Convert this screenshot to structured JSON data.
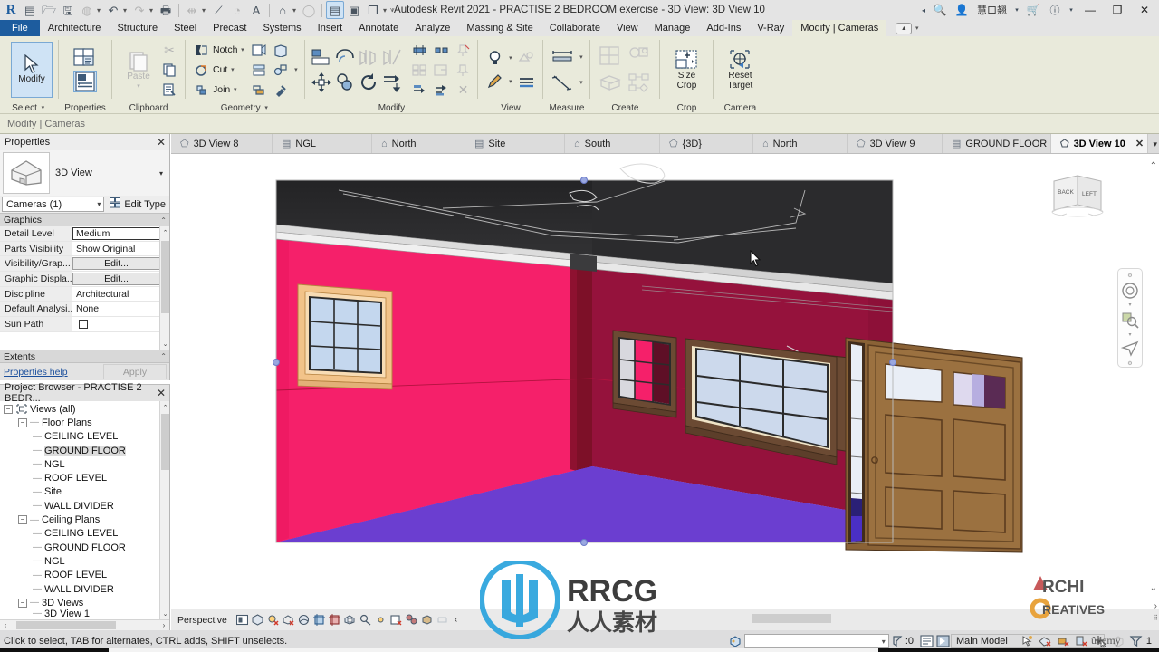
{
  "app": {
    "title": "Autodesk Revit 2021 - PRACTISE 2 BEDROOM exercise - 3D View: 3D View 10",
    "user": "慧口翘",
    "brand_color": "#1d5c9e",
    "ribbon_bg": "#e9eadb"
  },
  "quick_access": {
    "logo": "R",
    "items": [
      {
        "name": "new-project-icon",
        "glyph": "▤"
      },
      {
        "name": "open-icon",
        "glyph": "🗁"
      },
      {
        "name": "save-icon",
        "glyph": "🖫"
      },
      {
        "name": "save-as-icon",
        "glyph": "⬓"
      },
      {
        "name": "undo-icon",
        "glyph": "↶"
      },
      {
        "name": "redo-icon",
        "glyph": "↷"
      },
      {
        "name": "print-icon",
        "glyph": "🖨"
      },
      {
        "name": "measure-icon",
        "glyph": "⇹"
      },
      {
        "name": "aligned-dimension-icon",
        "glyph": "↗"
      },
      {
        "name": "tag-icon",
        "glyph": "◔"
      },
      {
        "name": "text-icon",
        "glyph": "A"
      },
      {
        "name": "default-3d-view-icon",
        "glyph": "⌂"
      },
      {
        "name": "section-icon",
        "glyph": "◯"
      },
      {
        "name": "thin-lines-icon",
        "glyph": "▤"
      },
      {
        "name": "close-hidden-windows-icon",
        "glyph": "▣"
      },
      {
        "name": "switch-windows-icon",
        "glyph": "❐"
      },
      {
        "name": "customize-qat-icon",
        "glyph": "▾"
      }
    ]
  },
  "window_controls": {
    "minimize": "—",
    "restore": "❐",
    "close": "✕",
    "search_icon": "🔍",
    "user_icon": "👤",
    "cart_icon": "🛒",
    "help_icon": "?",
    "prev_arrow": "◂"
  },
  "ribbon_tabs": {
    "items": [
      {
        "label": "File",
        "active": false,
        "file": true
      },
      {
        "label": "Architecture",
        "active": false
      },
      {
        "label": "Structure",
        "active": false
      },
      {
        "label": "Steel",
        "active": false
      },
      {
        "label": "Precast",
        "active": false
      },
      {
        "label": "Systems",
        "active": false
      },
      {
        "label": "Insert",
        "active": false
      },
      {
        "label": "Annotate",
        "active": false
      },
      {
        "label": "Analyze",
        "active": false
      },
      {
        "label": "Massing & Site",
        "active": false
      },
      {
        "label": "Collaborate",
        "active": false
      },
      {
        "label": "View",
        "active": false
      },
      {
        "label": "Manage",
        "active": false
      },
      {
        "label": "Add-Ins",
        "active": false
      },
      {
        "label": "V-Ray",
        "active": false
      },
      {
        "label": "Modify | Cameras",
        "active": true
      }
    ]
  },
  "ribbon_panels": {
    "select": {
      "title": "Select",
      "modify_label": "Modify",
      "modify_icon": "cursor-arrow-icon"
    },
    "properties": {
      "title": "Properties",
      "buttons": [
        {
          "name": "type-properties-icon"
        },
        {
          "name": "properties-palette-icon"
        }
      ]
    },
    "clipboard": {
      "title": "Clipboard",
      "paste_label": "Paste",
      "buttons": [
        {
          "name": "cut-icon"
        },
        {
          "name": "copy-icon"
        },
        {
          "name": "match-type-properties-icon"
        }
      ]
    },
    "geometry": {
      "title": "Geometry",
      "items": [
        {
          "name": "notch-button",
          "label": "Notch"
        },
        {
          "name": "cut-button",
          "label": "Cut"
        },
        {
          "name": "join-button",
          "label": "Join"
        }
      ]
    },
    "modify": {
      "title": "Modify",
      "items": [
        {
          "name": "align-icon"
        },
        {
          "name": "offset-icon"
        },
        {
          "name": "mirror-pick-axis-icon"
        },
        {
          "name": "mirror-draw-axis-icon"
        },
        {
          "name": "move-icon"
        },
        {
          "name": "copy-icon"
        },
        {
          "name": "rotate-icon"
        },
        {
          "name": "array-icon"
        },
        {
          "name": "trim-extend-icon"
        },
        {
          "name": "split-icon"
        },
        {
          "name": "pin-icon"
        },
        {
          "name": "unpin-icon"
        },
        {
          "name": "delete-icon"
        },
        {
          "name": "scale-icon"
        }
      ]
    },
    "view": {
      "title": "View",
      "items": [
        {
          "name": "hide-reveal-icon"
        },
        {
          "name": "render-icon"
        },
        {
          "name": "paint-icon"
        },
        {
          "name": "linework-icon"
        }
      ]
    },
    "measure": {
      "title": "Measure",
      "items": [
        {
          "name": "measure-between-references-icon"
        },
        {
          "name": "measure-along-element-icon"
        }
      ]
    },
    "create": {
      "title": "Create",
      "items": [
        {
          "name": "create-similar-icon"
        },
        {
          "name": "create-group-icon"
        },
        {
          "name": "create-part-icon"
        },
        {
          "name": "create-assembly-icon"
        }
      ]
    },
    "crop": {
      "title": "Crop",
      "button": {
        "name": "size-crop-button",
        "line1": "Size",
        "line2": "Crop"
      }
    },
    "camera": {
      "title": "Camera",
      "button": {
        "name": "reset-target-button",
        "line1": "Reset",
        "line2": "Target"
      }
    }
  },
  "options_bar": {
    "label": "Modify | Cameras"
  },
  "properties_palette": {
    "header": "Properties",
    "close": "✕",
    "type_name": "3D View",
    "instance_selector": "Cameras (1)",
    "edit_type": "Edit Type",
    "groups": [
      {
        "name": "Graphics",
        "rows": [
          {
            "name": "Detail Level",
            "value": "Medium",
            "kind": "boxed"
          },
          {
            "name": "Parts Visibility",
            "value": "Show Original",
            "kind": "text"
          },
          {
            "name": "Visibility/Grap...",
            "value": "Edit...",
            "kind": "button"
          },
          {
            "name": "Graphic Displa...",
            "value": "Edit...",
            "kind": "button"
          },
          {
            "name": "Discipline",
            "value": "Architectural",
            "kind": "text"
          },
          {
            "name": "Default Analysi...",
            "value": "None",
            "kind": "text"
          },
          {
            "name": "Sun Path",
            "value": "",
            "kind": "checkbox"
          }
        ]
      },
      {
        "name": "Extents",
        "rows": []
      }
    ],
    "help_link": "Properties help",
    "apply_button": "Apply"
  },
  "project_browser": {
    "header": "Project Browser - PRACTISE 2 BEDR...",
    "close": "✕",
    "nodes": [
      {
        "label": "Views (all)",
        "depth": 0,
        "expander": "−",
        "icon": "views-icon",
        "selected": false
      },
      {
        "label": "Floor Plans",
        "depth": 1,
        "expander": "−",
        "icon": "",
        "selected": false
      },
      {
        "label": "CEILING LEVEL",
        "depth": 2,
        "expander": "",
        "icon": "",
        "selected": false
      },
      {
        "label": "GROUND FLOOR",
        "depth": 2,
        "expander": "",
        "icon": "",
        "selected": true
      },
      {
        "label": "NGL",
        "depth": 2,
        "expander": "",
        "icon": "",
        "selected": false
      },
      {
        "label": "ROOF LEVEL",
        "depth": 2,
        "expander": "",
        "icon": "",
        "selected": false
      },
      {
        "label": "Site",
        "depth": 2,
        "expander": "",
        "icon": "",
        "selected": false
      },
      {
        "label": "WALL DIVIDER",
        "depth": 2,
        "expander": "",
        "icon": "",
        "selected": false
      },
      {
        "label": "Ceiling Plans",
        "depth": 1,
        "expander": "−",
        "icon": "",
        "selected": false
      },
      {
        "label": "CEILING LEVEL",
        "depth": 2,
        "expander": "",
        "icon": "",
        "selected": false
      },
      {
        "label": "GROUND FLOOR",
        "depth": 2,
        "expander": "",
        "icon": "",
        "selected": false
      },
      {
        "label": "NGL",
        "depth": 2,
        "expander": "",
        "icon": "",
        "selected": false
      },
      {
        "label": "ROOF LEVEL",
        "depth": 2,
        "expander": "",
        "icon": "",
        "selected": false
      },
      {
        "label": "WALL DIVIDER",
        "depth": 2,
        "expander": "",
        "icon": "",
        "selected": false
      },
      {
        "label": "3D Views",
        "depth": 1,
        "expander": "−",
        "icon": "",
        "selected": false
      },
      {
        "label": "3D View 1",
        "depth": 2,
        "expander": "",
        "icon": "",
        "selected": false
      }
    ]
  },
  "view_tabs": {
    "items": [
      {
        "label": "3D View 8",
        "icon": "3d-view-icon",
        "active": false
      },
      {
        "label": "NGL",
        "icon": "plan-view-icon",
        "active": false
      },
      {
        "label": "North",
        "icon": "elevation-view-icon",
        "active": false
      },
      {
        "label": "Site",
        "icon": "plan-view-icon",
        "active": false
      },
      {
        "label": "South",
        "icon": "elevation-view-icon",
        "active": false
      },
      {
        "label": "{3D}",
        "icon": "3d-view-icon",
        "active": false
      },
      {
        "label": "North",
        "icon": "elevation-view-icon",
        "active": false
      },
      {
        "label": "3D View 9",
        "icon": "3d-view-icon",
        "active": false
      },
      {
        "label": "GROUND FLOOR",
        "icon": "plan-view-icon",
        "active": false
      },
      {
        "label": "3D View 10",
        "icon": "3d-view-icon",
        "active": true,
        "close": "✕"
      }
    ],
    "overflow": "▾"
  },
  "scene": {
    "colors": {
      "ceiling": "#2b2b2d",
      "wall_left": "#f5206a",
      "wall_right": "#95123c",
      "floor": "#6b3ed0",
      "window_frame_tan": "#f2c389",
      "window_frame_brown": "#6b4a33",
      "glass": "#c4d7ee",
      "door": "#9b7140",
      "door_frame": "#8a6236"
    }
  },
  "view_cube": {
    "face_left": "BACK",
    "face_right": "LEFT"
  },
  "nav_bar": {
    "items": [
      {
        "name": "steering-wheel-icon"
      },
      {
        "name": "zoom-icon"
      },
      {
        "name": "fly-icon"
      }
    ]
  },
  "view_control_bar": {
    "projection": "Perspective",
    "icons": [
      {
        "name": "visual-style-icon"
      },
      {
        "name": "shadows-icon"
      },
      {
        "name": "sun-path-off-icon"
      },
      {
        "name": "shadows-off-icon"
      },
      {
        "name": "rendering-dialog-icon"
      },
      {
        "name": "crop-view-icon"
      },
      {
        "name": "show-crop-region-icon"
      },
      {
        "name": "lock-3d-view-icon"
      },
      {
        "name": "temporary-hide-isolate-icon"
      },
      {
        "name": "reveal-hidden-elements-icon"
      },
      {
        "name": "temporary-view-properties-icon"
      },
      {
        "name": "analytical-model-icon"
      },
      {
        "name": "constraints-icon"
      },
      {
        "name": "worksharing-display-icon"
      }
    ],
    "collapse": "‹"
  },
  "status_bar": {
    "message": "Click to select, TAB for alternates, CTRL adds, SHIFT unselects.",
    "filter_value": "",
    "exclude_options_count": ":0",
    "model_scope": "Main Model",
    "right_icons": [
      {
        "name": "editable-only-icon"
      },
      {
        "name": "select-links-icon"
      },
      {
        "name": "select-underlay-icon"
      },
      {
        "name": "select-pinned-icon"
      },
      {
        "name": "select-by-face-icon"
      },
      {
        "name": "drag-elements-icon"
      },
      {
        "name": "filter-icon"
      }
    ],
    "selection_count": "1"
  },
  "watermarks": {
    "rrcg": "RRCG",
    "rrcg_sub": "人人素材",
    "archi": "RCHI",
    "archi2": "REATIVES",
    "archi_a": "A",
    "archi_c": "C",
    "udemy": "ûdemy"
  }
}
